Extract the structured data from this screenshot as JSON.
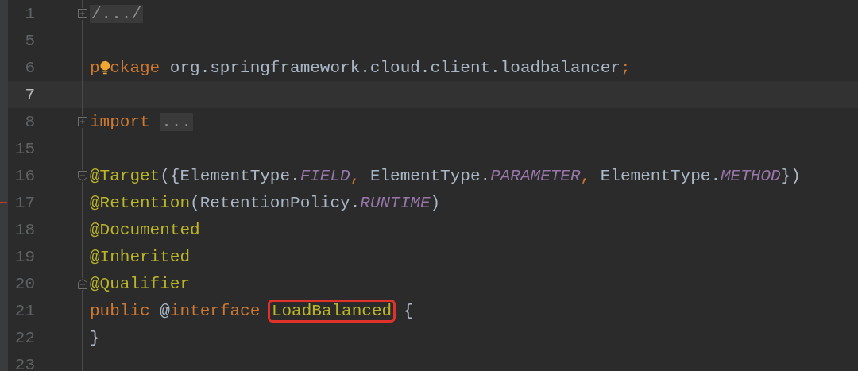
{
  "editor": {
    "lines": [
      {
        "number": "1",
        "current": false,
        "marked": false,
        "fold": {
          "kind": "expand"
        },
        "tokens": [
          {
            "kind": "folded",
            "text": "/.../"
          }
        ]
      },
      {
        "number": "5",
        "current": false,
        "marked": false
      },
      {
        "number": "6",
        "current": false,
        "marked": false,
        "tokens": [
          {
            "kind": "keyword",
            "text": "p"
          },
          {
            "kind": "bulb"
          },
          {
            "kind": "keyword",
            "text": "ckage"
          },
          {
            "kind": "plain",
            "text": " org.springframework.cloud.client.loadbalancer"
          },
          {
            "kind": "keyword",
            "text": ";"
          }
        ]
      },
      {
        "number": "7",
        "current": true,
        "marked": false
      },
      {
        "number": "8",
        "current": false,
        "marked": false,
        "fold": {
          "kind": "expand"
        },
        "tokens": [
          {
            "kind": "keyword",
            "text": "import "
          },
          {
            "kind": "folded",
            "text": "..."
          }
        ]
      },
      {
        "number": "15",
        "current": false,
        "marked": false
      },
      {
        "number": "16",
        "current": false,
        "marked": false,
        "fold": {
          "kind": "start"
        },
        "tokens": [
          {
            "kind": "annotation",
            "text": "@Target"
          },
          {
            "kind": "plain",
            "text": "({ElementType."
          },
          {
            "kind": "constant",
            "text": "FIELD"
          },
          {
            "kind": "keyword",
            "text": ", "
          },
          {
            "kind": "plain",
            "text": "ElementType."
          },
          {
            "kind": "constant",
            "text": "PARAMETER"
          },
          {
            "kind": "keyword",
            "text": ", "
          },
          {
            "kind": "plain",
            "text": "ElementType."
          },
          {
            "kind": "constant",
            "text": "METHOD"
          },
          {
            "kind": "plain",
            "text": "})"
          }
        ]
      },
      {
        "number": "17",
        "current": false,
        "marked": true,
        "tokens": [
          {
            "kind": "annotation",
            "text": "@Retention"
          },
          {
            "kind": "plain",
            "text": "(RetentionPolicy."
          },
          {
            "kind": "constant",
            "text": "RUNTIME"
          },
          {
            "kind": "plain",
            "text": ")"
          }
        ]
      },
      {
        "number": "18",
        "current": false,
        "marked": false,
        "tokens": [
          {
            "kind": "annotation",
            "text": "@Documented"
          }
        ]
      },
      {
        "number": "19",
        "current": false,
        "marked": false,
        "tokens": [
          {
            "kind": "annotation",
            "text": "@Inherited"
          }
        ]
      },
      {
        "number": "20",
        "current": false,
        "marked": false,
        "fold": {
          "kind": "end"
        },
        "tokens": [
          {
            "kind": "annotation",
            "text": "@Qualifier"
          }
        ]
      },
      {
        "number": "21",
        "current": false,
        "marked": false,
        "tokens": [
          {
            "kind": "keyword",
            "text": "public"
          },
          {
            "kind": "plain",
            "text": " @"
          },
          {
            "kind": "keyword",
            "text": "interface "
          },
          {
            "kind": "highlighted",
            "text": "LoadBalanced"
          },
          {
            "kind": "plain",
            "text": " {"
          }
        ]
      },
      {
        "number": "22",
        "current": false,
        "marked": false,
        "tokens": [
          {
            "kind": "plain",
            "text": "}"
          }
        ]
      },
      {
        "number": "23",
        "current": false,
        "marked": false
      }
    ]
  }
}
